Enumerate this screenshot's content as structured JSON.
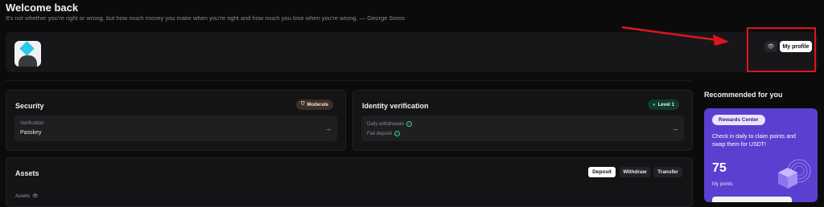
{
  "header": {
    "title": "Welcome back",
    "quote": "It's not whether you're right or wrong, but how much money you make when you're right and how much you lose when you're wrong. — George Soros"
  },
  "profile": {
    "my_profile_label": "My profile",
    "eye_icon": "👁"
  },
  "annotation": {
    "color": "#e0151b"
  },
  "security": {
    "title": "Security",
    "badge": "Moderate",
    "item_label": "Verification",
    "item_value": "Passkey",
    "arrow": "→"
  },
  "identity": {
    "title": "Identity verification",
    "badge": "Level 1",
    "daily_withdrawals": "Daily withdrawals",
    "fiat_deposit": "Fiat deposit",
    "arrow": "→"
  },
  "assets": {
    "title": "Assets",
    "deposit": "Deposit",
    "withdraw": "Withdraw",
    "transfer": "Transfer",
    "assets_label": "Assets"
  },
  "recommended": {
    "title": "Recommended for you",
    "pill": "Rewards Center",
    "text": "Check in daily to claim points and swap them for USDT!",
    "points": "75",
    "points_label": "My points"
  },
  "colors": {
    "accent": "#5b3fd0",
    "success": "#3ecf8e",
    "annotation": "#e0151b"
  }
}
